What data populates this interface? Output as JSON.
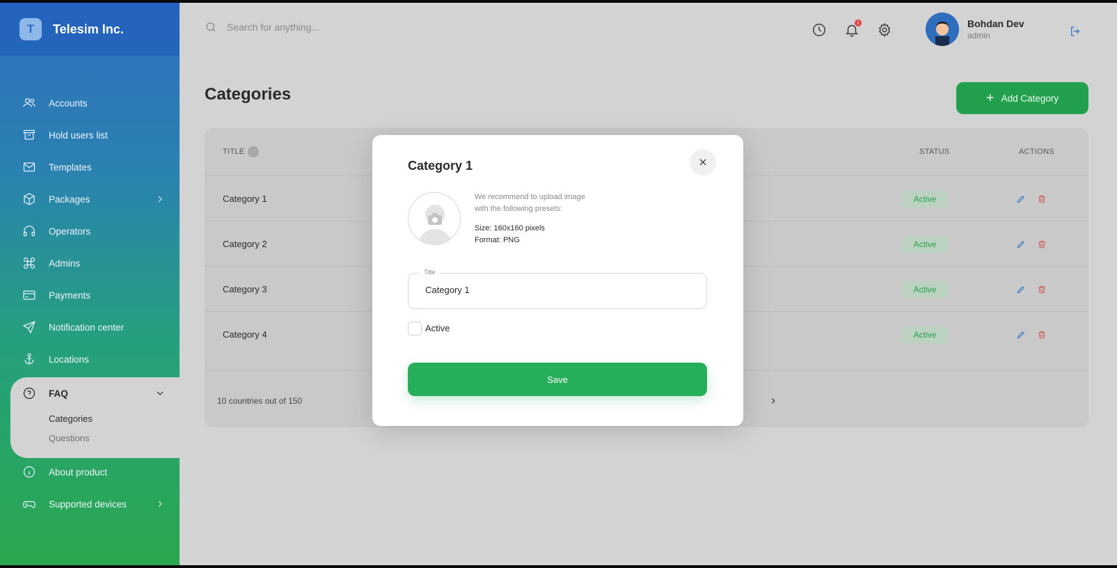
{
  "brand": {
    "logo_letter": "T",
    "name": "Telesim Inc."
  },
  "sidebar": {
    "items": [
      {
        "label": "Accounts",
        "icon": "users-icon"
      },
      {
        "label": "Hold users list",
        "icon": "archive-icon"
      },
      {
        "label": "Templates",
        "icon": "mail-icon"
      },
      {
        "label": "Packages",
        "icon": "box-icon"
      },
      {
        "label": "Operators",
        "icon": "headphones-icon"
      },
      {
        "label": "Admins",
        "icon": "command-icon"
      },
      {
        "label": "Payments",
        "icon": "credit-card-icon"
      },
      {
        "label": "Notification center",
        "icon": "send-icon"
      },
      {
        "label": "Locations",
        "icon": "anchor-icon"
      }
    ],
    "faq": {
      "label": "FAQ",
      "sub": [
        "Categories",
        "Questions"
      ]
    },
    "after": [
      {
        "label": "About product",
        "icon": "info-icon"
      },
      {
        "label": "Supported devices",
        "icon": "gamepad-icon"
      }
    ]
  },
  "topbar": {
    "search_placeholder": "Search for anything...",
    "notification_count": "1",
    "user": {
      "name": "Bohdan Dev",
      "role": "admin"
    }
  },
  "main": {
    "title": "Categories",
    "add_button": "Add Category",
    "columns": {
      "title": "TITLE",
      "status": "STATUS",
      "actions": "ACTIONS"
    },
    "rows": [
      {
        "title": "Category 1",
        "status": "Active"
      },
      {
        "title": "Category 2",
        "status": "Active"
      },
      {
        "title": "Category 3",
        "status": "Active"
      },
      {
        "title": "Category 4",
        "status": "Active"
      }
    ],
    "footer": "10 countries out of 150"
  },
  "modal": {
    "title": "Category 1",
    "hint_line1": "We recommend to upload image",
    "hint_line2": "with the following presets:",
    "size": "Size: 160x160 pixels",
    "format": "Format: PNG",
    "field_label": "Title",
    "field_value": "Category 1",
    "checkbox_label": "Active",
    "save_label": "Save"
  },
  "colors": {
    "accent_green": "#23a04e",
    "accent_blue": "#2f6ebf",
    "danger": "#d04a4a"
  }
}
